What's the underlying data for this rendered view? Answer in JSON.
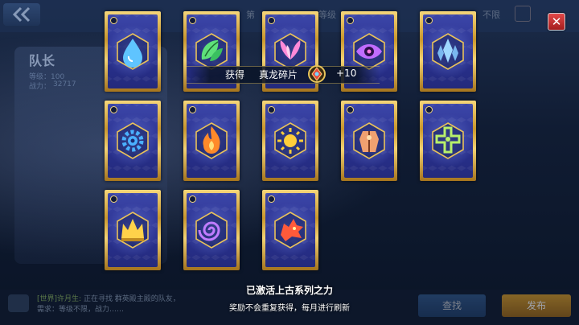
{
  "background": {
    "filter_labels": [
      "第",
      "等级",
      "不限"
    ],
    "captain": {
      "title": "队长",
      "level_label": "等级：100",
      "power_label": "战力：",
      "power_value": "32717"
    },
    "chat": {
      "channel": "[世界]许月生:",
      "message": "正在寻找 群英殿主殿的队友，需求：等级不限，战力……"
    },
    "send_button": "查找",
    "publish_button": "发布"
  },
  "reward": {
    "get_label": "获得",
    "item_name": "真龙碎片",
    "count": "+10"
  },
  "message": {
    "title": "已激活上古系列之力",
    "subtitle": "奖励不会重复获得，每月进行刷新"
  },
  "cards": [
    {
      "icon": "water-drop-icon",
      "color": "#5fc4ff"
    },
    {
      "icon": "leaf-icon",
      "color": "#5ee07a"
    },
    {
      "icon": "wing-icon",
      "color": "#ff8ad8"
    },
    {
      "icon": "eye-icon",
      "color": "#c06cff"
    },
    {
      "icon": "crystal-icon",
      "color": "#9fd8ff"
    },
    {
      "icon": "gear-icon",
      "color": "#4ab0ff"
    },
    {
      "icon": "flame-icon",
      "color": "#ff8a2a"
    },
    {
      "icon": "sun-icon",
      "color": "#ffce3a"
    },
    {
      "icon": "armor-icon",
      "color": "#f0a070"
    },
    {
      "icon": "cross-icon",
      "color": "#b8f06a"
    },
    {
      "icon": "crown-icon",
      "color": "#ffd24a"
    },
    {
      "icon": "vortex-icon",
      "color": "#c07cff"
    },
    {
      "icon": "dragon-head-icon",
      "color": "#ff5a3a"
    }
  ],
  "colors": {
    "gold": "#e9c25a",
    "card_blue": "#2e3796",
    "close_red": "#d03434"
  }
}
